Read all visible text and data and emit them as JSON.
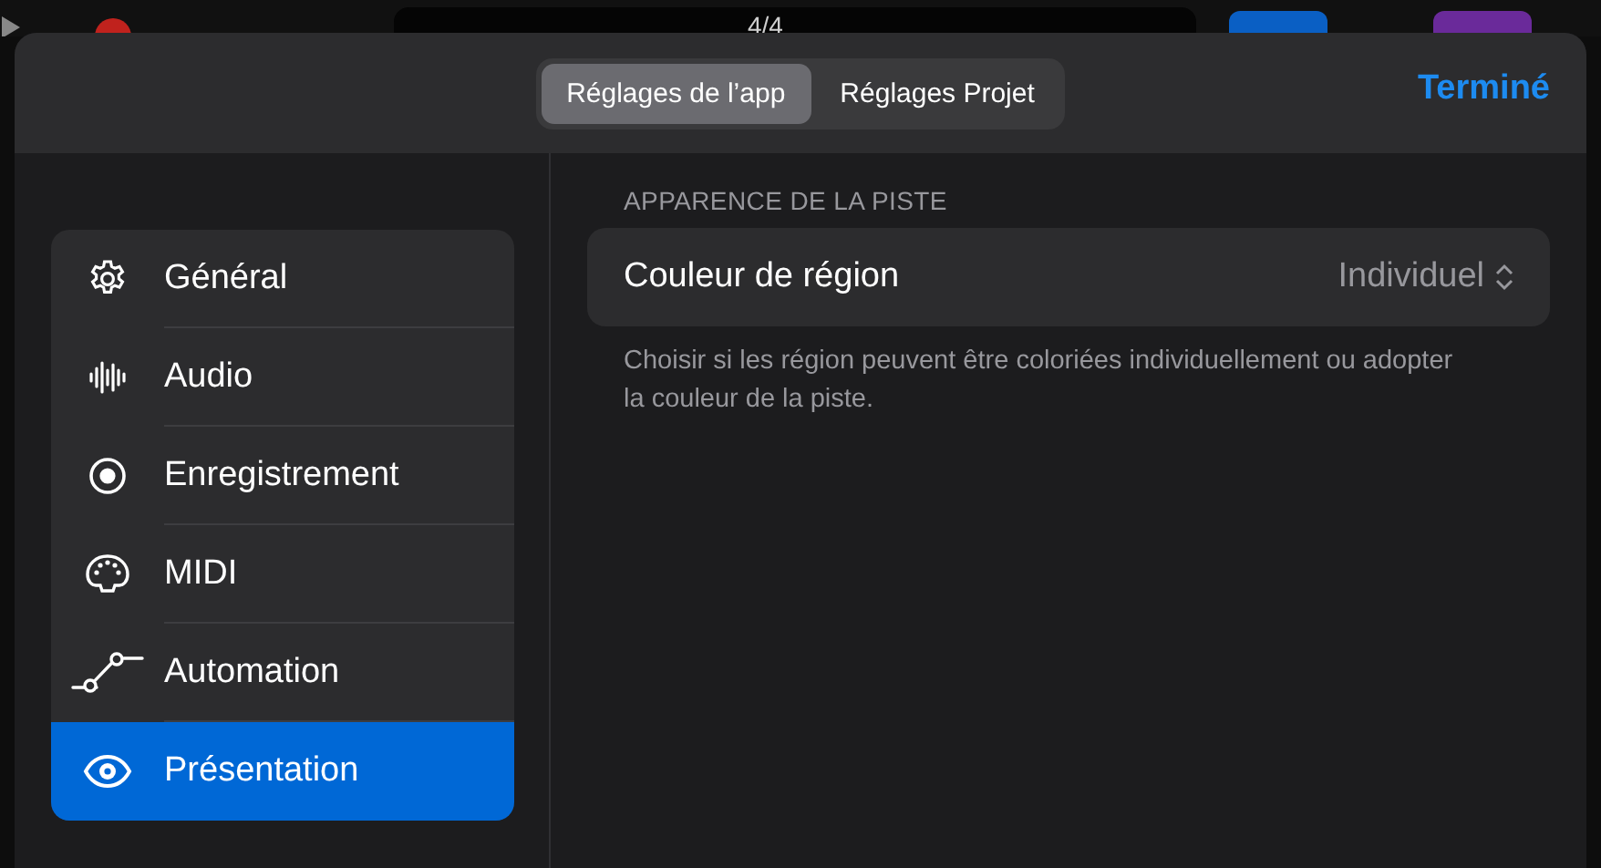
{
  "background_toolbar": {
    "time_signature": "4/4"
  },
  "header": {
    "segments": [
      {
        "label": "Réglages de l’app",
        "selected": true
      },
      {
        "label": "Réglages Projet",
        "selected": false
      }
    ],
    "done_button": "Terminé"
  },
  "sidebar": {
    "items": [
      {
        "kind": "gear",
        "label": "Général",
        "selected": false
      },
      {
        "kind": "waveform",
        "label": "Audio",
        "selected": false
      },
      {
        "kind": "record",
        "label": "Enregistrement",
        "selected": false
      },
      {
        "kind": "midi",
        "label": "MIDI",
        "selected": false
      },
      {
        "kind": "automation",
        "label": "Automation",
        "selected": false
      },
      {
        "kind": "eye",
        "label": "Présentation",
        "selected": true
      }
    ]
  },
  "section": {
    "heading": "APPARENCE DE LA PISTE",
    "rows": [
      {
        "label": "Couleur de région",
        "value": "Individuel"
      }
    ],
    "footer": "Choisir si les région peuvent être coloriées individuellement ou adopter la couleur de la piste."
  }
}
